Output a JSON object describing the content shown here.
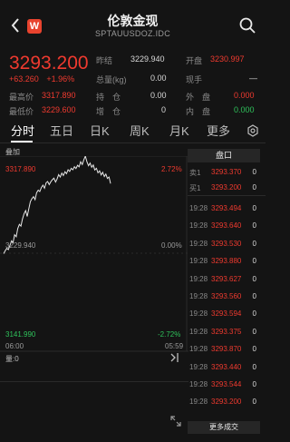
{
  "header": {
    "back_icon": "back-chevron-icon",
    "logo_text": "W",
    "title": "伦敦金现",
    "subtitle": "SPTAUUSDOZ.IDC",
    "search_icon": "search-icon"
  },
  "quote": {
    "price": "3293.200",
    "change_abs": "+63.260",
    "change_pct": "+1.96%",
    "fields": {
      "prev_close_label": "昨结",
      "prev_close": "3229.940",
      "open_label": "开盘",
      "open": "3230.997",
      "total_vol_label": "总量(kg)",
      "total_vol": "0.00",
      "current_lots_label": "现手",
      "current_lots": "—",
      "high_label": "最高价",
      "high": "3317.890",
      "hold_label": "持　仓",
      "hold": "0.00",
      "outer_label": "外　盘",
      "outer": "0.000",
      "low_label": "最低价",
      "low": "3229.600",
      "increase_label": "增　仓",
      "increase": "0",
      "inner_label": "内　盘",
      "inner": "0.000"
    }
  },
  "tabs": [
    "分时",
    "五日",
    "日K",
    "周K",
    "月K",
    "更多"
  ],
  "tab_settings_icon": "settings-icon",
  "chart_data": {
    "type": "line",
    "legend": "叠加",
    "y_labels": {
      "high": "3317.890",
      "mid": "3229.940",
      "low": "3141.990"
    },
    "pct_labels": {
      "high": "2.72%",
      "mid": "0.00%",
      "low": "-2.72%"
    },
    "x_labels": {
      "start": "06:00",
      "end": "05:59"
    },
    "ylim": [
      3141.99,
      3317.89
    ],
    "points": [
      3229.94,
      3232.5,
      3234.8,
      3233.6,
      3237.2,
      3241.5,
      3239.9,
      3247.0,
      3245.2,
      3252.6,
      3256.4,
      3254.7,
      3261.2,
      3266.0,
      3268.8,
      3263.5,
      3270.4,
      3276.8,
      3279.5,
      3281.3,
      3278.6,
      3284.9,
      3287.2,
      3286.0,
      3289.5,
      3291.7,
      3288.9,
      3293.8,
      3295.0,
      3292.2,
      3294.8,
      3296.6,
      3298.0,
      3294.5,
      3297.3,
      3301.2,
      3299.0,
      3302.6,
      3300.4,
      3303.8,
      3302.0,
      3305.6,
      3304.1,
      3306.9,
      3305.5,
      3308.3,
      3306.7,
      3309.6,
      3308.2,
      3312.8,
      3310.3,
      3314.5,
      3317.89,
      3312.6,
      3309.2,
      3311.6,
      3307.8,
      3309.9,
      3305.4,
      3306.9,
      3302.8,
      3304.6,
      3300.9,
      3303.3,
      3299.5,
      3301.7,
      3297.8,
      3299.1,
      3293.2
    ]
  },
  "bottom": {
    "vol_label": "量:0",
    "exp_icon": "expand-right-icon",
    "fullscreen_icon": "fullscreen-icon"
  },
  "side": {
    "pankou": "盘口",
    "sell1_label": "卖1",
    "sell1_price": "3293.370",
    "sell1_qty": "0",
    "buy1_label": "买1",
    "buy1_price": "3293.200",
    "buy1_qty": "0",
    "ticks": [
      {
        "t": "19:28",
        "p": "3293.494",
        "q": "0"
      },
      {
        "t": "19:28",
        "p": "3293.640",
        "q": "0"
      },
      {
        "t": "19:28",
        "p": "3293.530",
        "q": "0"
      },
      {
        "t": "19:28",
        "p": "3293.880",
        "q": "0"
      },
      {
        "t": "19:28",
        "p": "3293.627",
        "q": "0"
      },
      {
        "t": "19:28",
        "p": "3293.560",
        "q": "0"
      },
      {
        "t": "19:28",
        "p": "3293.594",
        "q": "0"
      },
      {
        "t": "19:28",
        "p": "3293.375",
        "q": "0"
      },
      {
        "t": "19:28",
        "p": "3293.870",
        "q": "0"
      },
      {
        "t": "19:28",
        "p": "3293.440",
        "q": "0"
      },
      {
        "t": "19:28",
        "p": "3293.544",
        "q": "0"
      },
      {
        "t": "19:28",
        "p": "3293.200",
        "q": "0"
      }
    ],
    "more": "更多成交"
  },
  "colors": {
    "bg": "#141414",
    "up": "#ef3a2f",
    "down": "#2fc25b",
    "text": "#d8d8d8"
  }
}
